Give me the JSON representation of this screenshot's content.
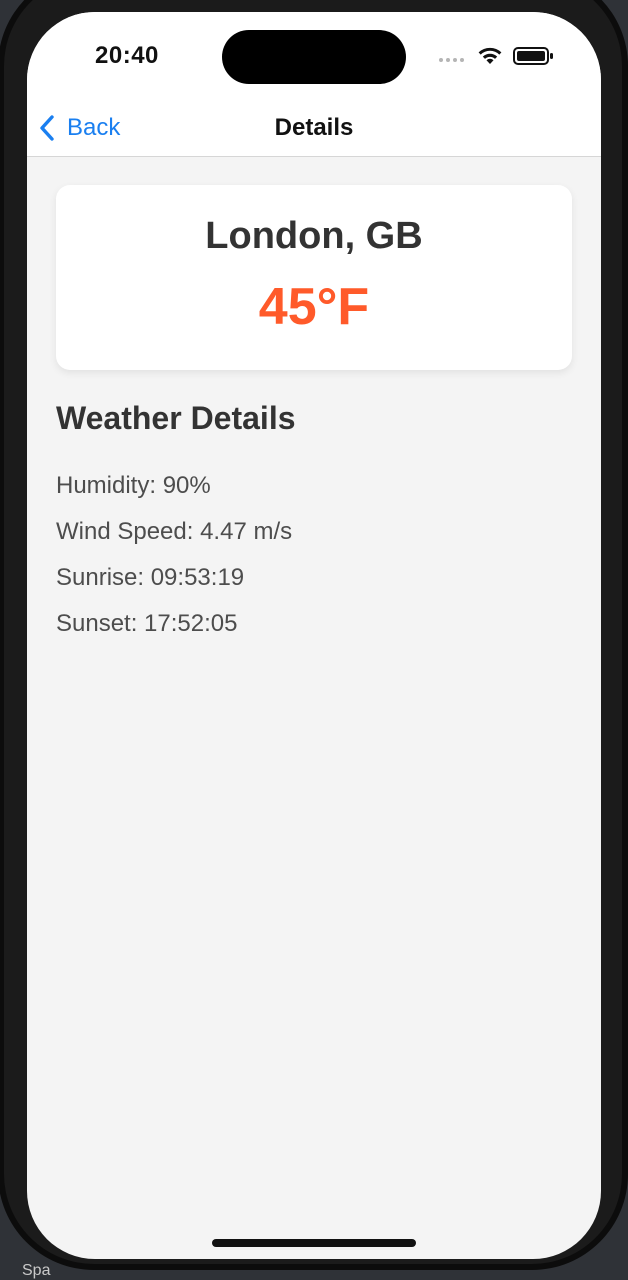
{
  "background": {
    "partial_text": "Spa"
  },
  "status_bar": {
    "time": "20:40"
  },
  "nav": {
    "back_label": "Back",
    "title": "Details"
  },
  "city_card": {
    "city": "London, GB",
    "temperature": "45°F"
  },
  "details": {
    "heading": "Weather Details",
    "items": [
      "Humidity: 90%",
      "Wind Speed: 4.47 m/s",
      "Sunrise: 09:53:19",
      "Sunset: 17:52:05"
    ]
  },
  "colors": {
    "accent_blue": "#1a7ff0",
    "temperature_orange": "#ff5a2a",
    "screen_background": "#f4f4f4",
    "card_background": "#ffffff"
  }
}
